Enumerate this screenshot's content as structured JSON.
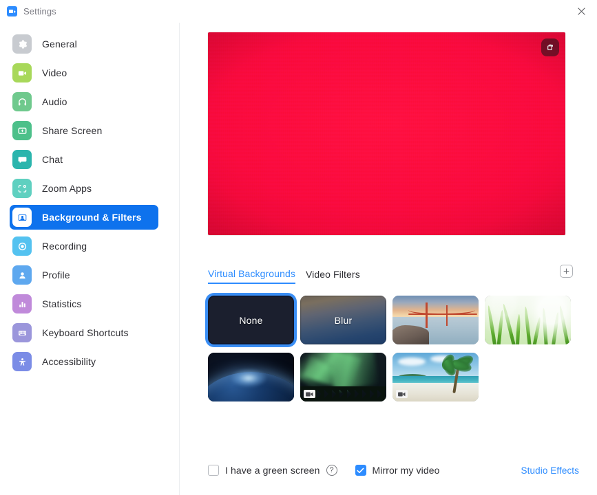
{
  "window": {
    "title": "Settings",
    "logo_icon": "zoom-camera-icon",
    "close_icon": "close-x-icon"
  },
  "sidebar": {
    "items": [
      {
        "label": "General",
        "icon": "gear-icon",
        "color": "#c8cbd0",
        "active": false
      },
      {
        "label": "Video",
        "icon": "video-camera-icon",
        "color": "#a8d85a",
        "active": false
      },
      {
        "label": "Audio",
        "icon": "headphones-icon",
        "color": "#6fc98d",
        "active": false
      },
      {
        "label": "Share Screen",
        "icon": "share-screen-icon",
        "color": "#4dc08a",
        "active": false
      },
      {
        "label": "Chat",
        "icon": "chat-bubble-icon",
        "color": "#2bb5ad",
        "active": false
      },
      {
        "label": "Zoom Apps",
        "icon": "zoom-apps-icon",
        "color": "#5fd0c0",
        "active": false
      },
      {
        "label": "Background & Filters",
        "icon": "background-user-icon",
        "color": "#ffffff",
        "active": true
      },
      {
        "label": "Recording",
        "icon": "record-circle-icon",
        "color": "#54c2f0",
        "active": false
      },
      {
        "label": "Profile",
        "icon": "person-icon",
        "color": "#5ea8ef",
        "active": false
      },
      {
        "label": "Statistics",
        "icon": "bar-chart-icon",
        "color": "#c08ada",
        "active": false
      },
      {
        "label": "Keyboard Shortcuts",
        "icon": "keyboard-icon",
        "color": "#9b96db",
        "active": false
      },
      {
        "label": "Accessibility",
        "icon": "accessibility-icon",
        "color": "#7b8ce6",
        "active": false
      }
    ],
    "active_label": "Background & Filters",
    "active_color": "#0e72ed"
  },
  "preview": {
    "mirror_button_icon": "flip-rotate-icon",
    "background_color": "#fa0a3d"
  },
  "tabs": [
    {
      "label": "Virtual Backgrounds",
      "active": true
    },
    {
      "label": "Video Filters",
      "active": false
    }
  ],
  "add_button": {
    "icon": "plus-icon",
    "label": "+"
  },
  "thumbnails": [
    {
      "label": "None",
      "art": "none",
      "selected": true,
      "video": false
    },
    {
      "label": "Blur",
      "art": "blur",
      "selected": false,
      "video": false
    },
    {
      "label": "",
      "art": "bridge",
      "selected": false,
      "video": false
    },
    {
      "label": "",
      "art": "grass",
      "selected": false,
      "video": false
    },
    {
      "label": "",
      "art": "earth",
      "selected": false,
      "video": false
    },
    {
      "label": "",
      "art": "aurora",
      "selected": false,
      "video": true
    },
    {
      "label": "",
      "art": "beach",
      "selected": false,
      "video": true
    }
  ],
  "bottom": {
    "green_screen_label": "I have a green screen",
    "green_screen_checked": false,
    "help_icon": "question-mark-icon",
    "help_glyph": "?",
    "mirror_label": "Mirror my video",
    "mirror_checked": true,
    "studio_effects_label": "Studio Effects",
    "link_color": "#2d8cff"
  }
}
